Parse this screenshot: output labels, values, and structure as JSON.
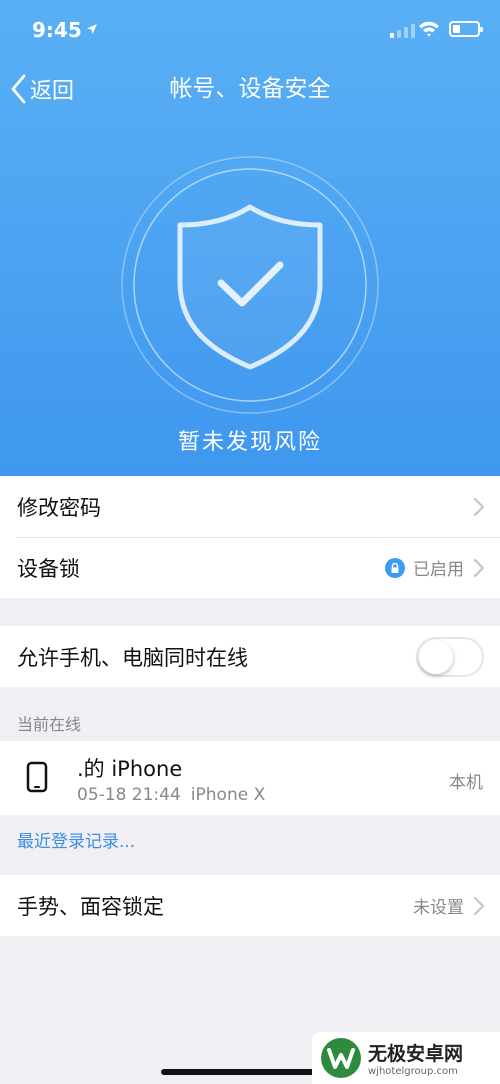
{
  "status_bar": {
    "time": "9:45"
  },
  "nav": {
    "back_label": "返回",
    "title": "帐号、设备安全"
  },
  "hero": {
    "status_text": "暂未发现风险"
  },
  "security_items": [
    {
      "label": "修改密码",
      "value": ""
    },
    {
      "label": "设备锁",
      "value": "已启用"
    }
  ],
  "online_toggle": {
    "label": "允许手机、电脑同时在线",
    "enabled": false
  },
  "current_online": {
    "header": "当前在线",
    "device_name": ".的 iPhone",
    "login_time": "05-18 21:44",
    "device_model": "iPhone X",
    "tag": "本机"
  },
  "recent_login_link": "最近登录记录...",
  "gesture_lock": {
    "label": "手势、面容锁定",
    "value": "未设置"
  },
  "watermark": {
    "title": "无极安卓网",
    "url": "wjhotelgroup.com"
  },
  "colors": {
    "hero_top": "#5ab0f4",
    "hero_bottom": "#3f97ef",
    "accent": "#3b9cf1",
    "link": "#3b8fe0"
  }
}
